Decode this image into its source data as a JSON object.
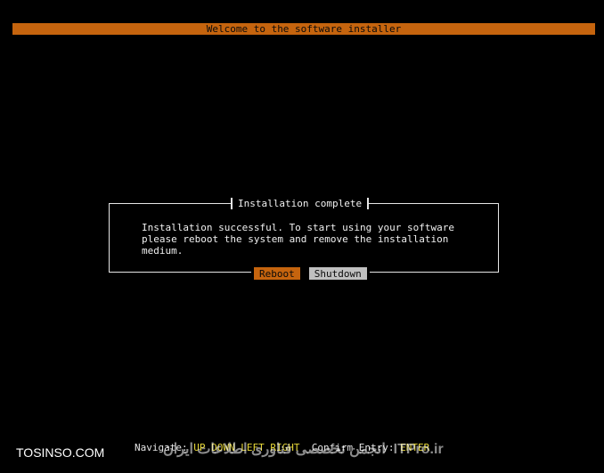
{
  "header": {
    "title": "Welcome to the software installer"
  },
  "dialog": {
    "title": "Installation complete",
    "message": "Installation successful. To start using your software\nplease reboot the system and remove the installation\nmedium.",
    "buttons": {
      "reboot": "Reboot",
      "shutdown": "Shutdown"
    }
  },
  "nav": {
    "label": "Navigate:",
    "up": "UP",
    "down": "DOWN",
    "left": "LEFT",
    "right": "RIGHT",
    "confirm_label": "Confirm Entry:",
    "enter": "ENTER"
  },
  "watermarks": {
    "left": "TOSINSO.COM",
    "right": "انجمن تخصصی فناوری اطلاعات ایران  ITPro.ir"
  },
  "colors": {
    "accent": "#c5640e",
    "secondary_button": "#c0c0c0",
    "key_highlight": "#e8d838",
    "background": "#000000"
  }
}
